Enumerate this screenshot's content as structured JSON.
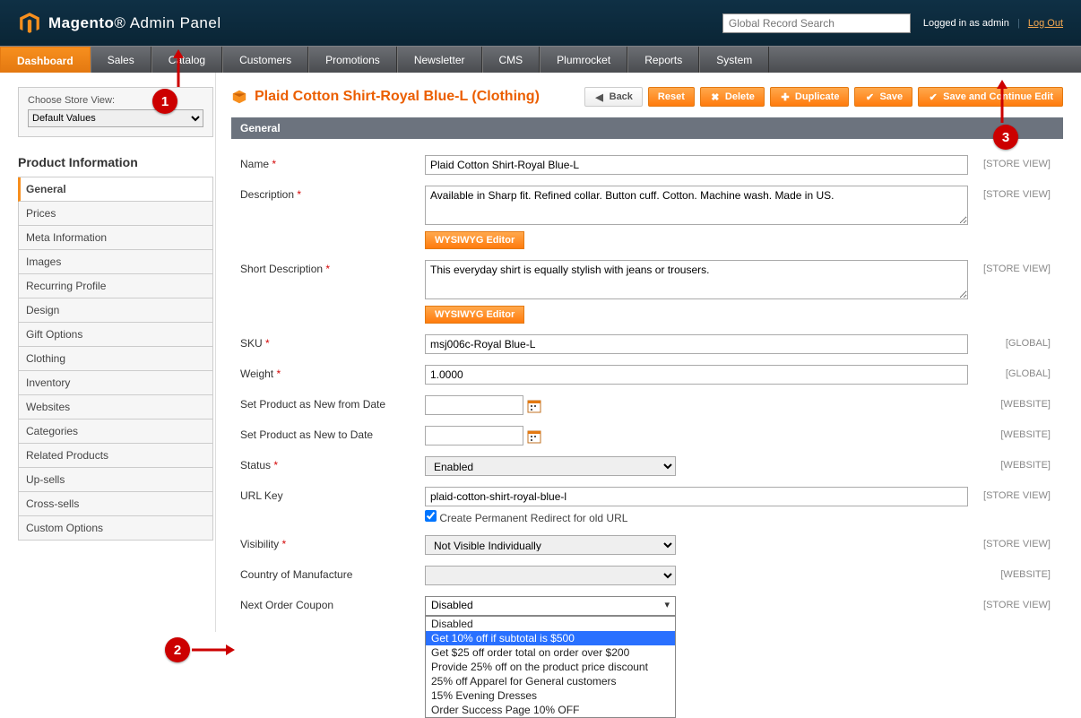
{
  "header": {
    "brand_main": "Magento",
    "brand_sub": "Admin Panel",
    "search_placeholder": "Global Record Search",
    "login_text": "Logged in as admin",
    "logout": "Log Out"
  },
  "nav": [
    {
      "label": "Dashboard",
      "active": true
    },
    {
      "label": "Sales"
    },
    {
      "label": "Catalog"
    },
    {
      "label": "Customers"
    },
    {
      "label": "Promotions"
    },
    {
      "label": "Newsletter"
    },
    {
      "label": "CMS"
    },
    {
      "label": "Plumrocket"
    },
    {
      "label": "Reports"
    },
    {
      "label": "System"
    }
  ],
  "store_view": {
    "label": "Choose Store View:",
    "value": "Default Values"
  },
  "sidebar": {
    "title": "Product Information",
    "tabs": [
      {
        "label": "General",
        "active": true
      },
      {
        "label": "Prices"
      },
      {
        "label": "Meta Information"
      },
      {
        "label": "Images"
      },
      {
        "label": "Recurring Profile"
      },
      {
        "label": "Design"
      },
      {
        "label": "Gift Options"
      },
      {
        "label": "Clothing"
      },
      {
        "label": "Inventory"
      },
      {
        "label": "Websites"
      },
      {
        "label": "Categories"
      },
      {
        "label": "Related Products"
      },
      {
        "label": "Up-sells"
      },
      {
        "label": "Cross-sells"
      },
      {
        "label": "Custom Options"
      }
    ]
  },
  "page": {
    "title": "Plaid Cotton Shirt-Royal Blue-L (Clothing)",
    "buttons": {
      "back": "Back",
      "reset": "Reset",
      "delete": "Delete",
      "duplicate": "Duplicate",
      "save": "Save",
      "save_continue": "Save and Continue Edit"
    }
  },
  "panel": {
    "title": "General"
  },
  "scopes": {
    "store": "[STORE VIEW]",
    "global": "[GLOBAL]",
    "website": "[WEBSITE]"
  },
  "form": {
    "name": {
      "label": "Name",
      "value": "Plaid Cotton Shirt-Royal Blue-L"
    },
    "description": {
      "label": "Description",
      "value": "Available in Sharp fit. Refined collar. Button cuff. Cotton. Machine wash. Made in US."
    },
    "short_description": {
      "label": "Short Description",
      "value": "This everyday shirt is equally stylish with jeans or trousers."
    },
    "wysiwyg": "WYSIWYG Editor",
    "sku": {
      "label": "SKU",
      "value": "msj006c-Royal Blue-L"
    },
    "weight": {
      "label": "Weight",
      "value": "1.0000"
    },
    "new_from": {
      "label": "Set Product as New from Date",
      "value": ""
    },
    "new_to": {
      "label": "Set Product as New to Date",
      "value": ""
    },
    "status": {
      "label": "Status",
      "value": "Enabled"
    },
    "url_key": {
      "label": "URL Key",
      "value": "plaid-cotton-shirt-royal-blue-l",
      "redirect": "Create Permanent Redirect for old URL"
    },
    "visibility": {
      "label": "Visibility",
      "value": "Not Visible Individually"
    },
    "country": {
      "label": "Country of Manufacture",
      "value": ""
    },
    "next_coupon": {
      "label": "Next Order Coupon",
      "value": "Disabled",
      "options": [
        "Disabled",
        "Get 10% off if subtotal is $500",
        "Get $25 off order total on order over $200",
        "Provide 25% off on the product price discount",
        "25% off Apparel for General customers",
        "15% Evening Dresses",
        "Order Success Page 10% OFF"
      ],
      "highlighted": 1
    }
  },
  "callouts": {
    "c1": "1",
    "c2": "2",
    "c3": "3"
  }
}
